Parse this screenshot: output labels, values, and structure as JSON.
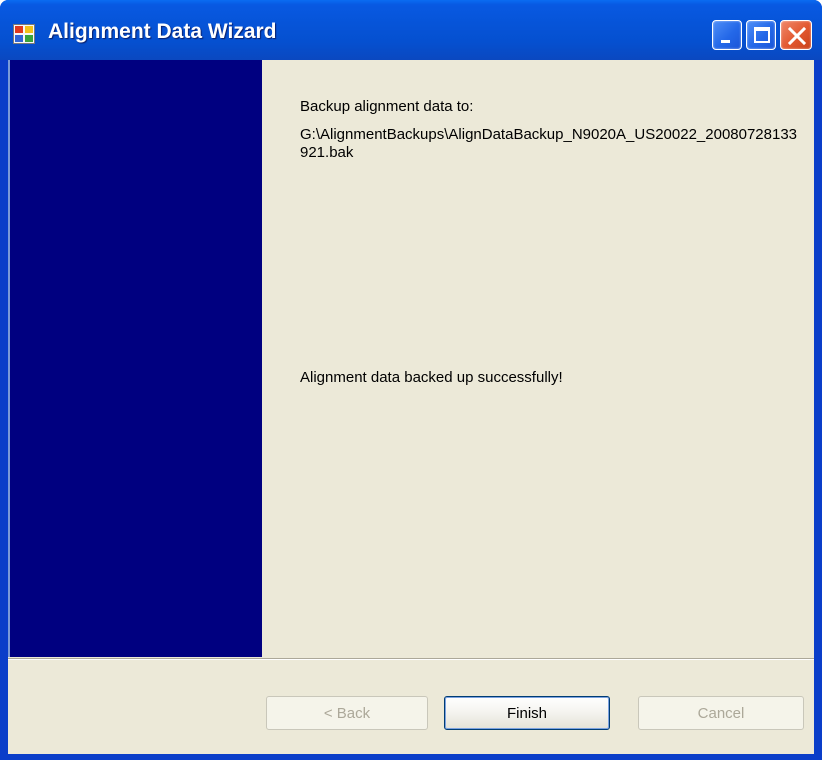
{
  "window": {
    "title": "Alignment Data Wizard",
    "icon": "app-window-icon",
    "controls": {
      "minimize_icon": "minimize-icon",
      "maximize_icon": "maximize-icon",
      "close_icon": "close-icon"
    }
  },
  "content": {
    "backup_label": "Backup alignment data to:",
    "backup_path": "G:\\AlignmentBackups\\AlignDataBackup_N9020A_US20022_20080728133921.bak",
    "status_message": "Alignment data backed up successfully!"
  },
  "buttons": {
    "back": {
      "label": "< Back",
      "enabled": false
    },
    "finish": {
      "label": "Finish",
      "enabled": true
    },
    "cancel": {
      "label": "Cancel",
      "enabled": false
    }
  },
  "colors": {
    "titlebar": "#0654d8",
    "side_panel": "#000080",
    "client_background": "#ece9d8",
    "close_button": "#e2582f"
  }
}
